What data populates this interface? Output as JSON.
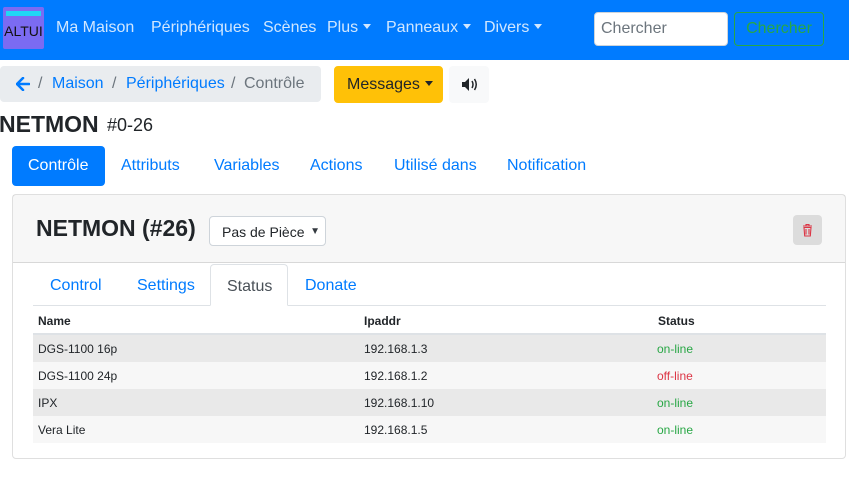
{
  "brand": {
    "label": "ALTUI"
  },
  "nav": {
    "items": [
      {
        "label": "Ma Maison",
        "dropdown": false
      },
      {
        "label": "Périphériques",
        "dropdown": false
      },
      {
        "label": "Scènes",
        "dropdown": false
      },
      {
        "label": "Plus",
        "dropdown": true
      },
      {
        "label": "Panneaux",
        "dropdown": true
      },
      {
        "label": "Divers",
        "dropdown": true
      }
    ],
    "search_placeholder": "Chercher",
    "search_button": "Chercher"
  },
  "breadcrumb": {
    "items": [
      "Maison",
      "Périphériques"
    ],
    "active": "Contrôle",
    "separator": "/"
  },
  "messages_button": "Messages",
  "device": {
    "name": "NETMON",
    "id": "#0-26"
  },
  "pills": [
    "Contrôle",
    "Attributs",
    "Variables",
    "Actions",
    "Utilisé dans",
    "Notification"
  ],
  "card": {
    "title": "NETMON (#26)",
    "room_select": "Pas de Pièce",
    "tabs": [
      "Control",
      "Settings",
      "Status",
      "Donate"
    ],
    "active_tab": "Status"
  },
  "table": {
    "headers": [
      "Name",
      "Ipaddr",
      "Status"
    ],
    "rows": [
      {
        "name": "DGS-1100 16p",
        "ip": "192.168.1.3",
        "status": "on-line"
      },
      {
        "name": "DGS-1100 24p",
        "ip": "192.168.1.2",
        "status": "off-line"
      },
      {
        "name": "IPX",
        "ip": "192.168.1.10",
        "status": "on-line"
      },
      {
        "name": "Vera Lite",
        "ip": "192.168.1.5",
        "status": "on-line"
      }
    ]
  },
  "colors": {
    "primary": "#007bff",
    "warning": "#ffc107",
    "success": "#28a745",
    "danger": "#dc3545",
    "brand_bg": "#7b6bf2"
  },
  "icons": {
    "back": "arrow-left-icon",
    "sound": "volume-icon",
    "delete": "trash-icon",
    "room_select": "chevron-down-icon"
  }
}
